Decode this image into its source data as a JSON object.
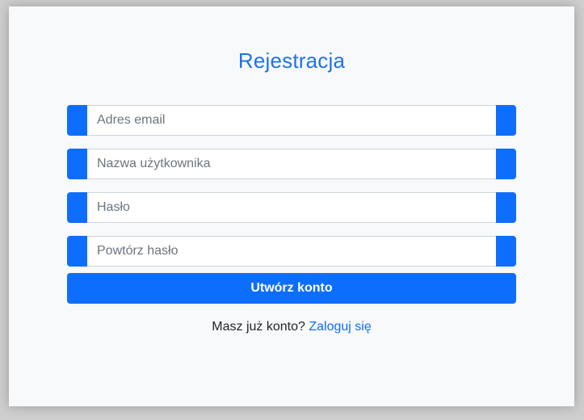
{
  "form": {
    "title": "Rejestracja",
    "fields": [
      {
        "placeholder": "Adres email"
      },
      {
        "placeholder": "Nazwa użytkownika"
      },
      {
        "placeholder": "Hasło"
      },
      {
        "placeholder": "Powtórz hasło"
      }
    ],
    "submit_label": "Utwórz konto"
  },
  "footer": {
    "text": "Masz już konto?",
    "link_label": "Zaloguj się"
  },
  "colors": {
    "accent": "#0d6efd",
    "title": "#1e73e8",
    "background": "#f8f9fa"
  }
}
